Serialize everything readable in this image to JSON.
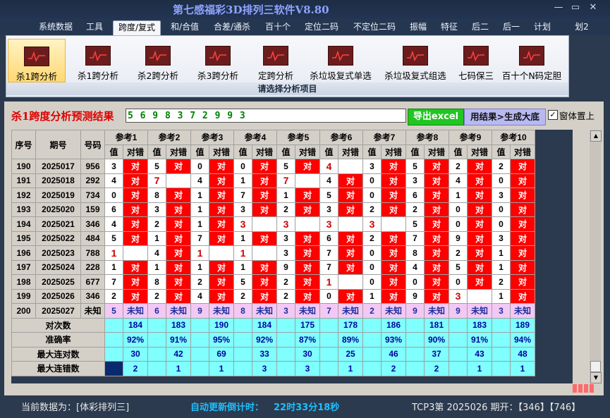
{
  "window": {
    "title": "第七感福彩3D排列三软件V8.80",
    "min": "—",
    "max": "▭",
    "close": "✕"
  },
  "menu": [
    "系统数据",
    "工具",
    "跨度/复式",
    "和/合值",
    "合差/通杀",
    "百十个",
    "定位二码",
    "不定位二码",
    "振幅",
    "特征",
    "后二",
    "后一",
    "计划",
    "划2"
  ],
  "menu_active": 2,
  "ribbon": {
    "buttons": [
      "杀1跨分析",
      "杀1跨分析",
      "杀2跨分析",
      "杀3跨分析",
      "定跨分析",
      "杀垃圾复式单选",
      "杀垃圾复式组选",
      "七码保三",
      "百十个N码定胆"
    ],
    "active": 0,
    "group_label": "请选择分析项目"
  },
  "result": {
    "heading": "杀1跨度分析预测结果",
    "digits": "5 6 9 8 3 7 2 9 9 3",
    "export_label": "导出excel",
    "generate_label": "用结果>生成大底",
    "pin_label": "窗体置上",
    "pin_checked": "✓"
  },
  "table": {
    "col_headers": {
      "seq": "序号",
      "period": "期号",
      "code": "号码",
      "val": "值",
      "mark": "对错"
    },
    "refs": [
      "参考1",
      "参考2",
      "参考3",
      "参考4",
      "参考5",
      "参考6",
      "参考7",
      "参考8",
      "参考9",
      "参考10"
    ],
    "rows": [
      {
        "seq": "190",
        "period": "2025017",
        "code": "956",
        "cells": [
          [
            "3",
            "对"
          ],
          [
            "5",
            "对"
          ],
          [
            "0",
            "对"
          ],
          [
            "0",
            "对"
          ],
          [
            "5",
            "对"
          ],
          [
            "4",
            ""
          ],
          [
            "3",
            "对"
          ],
          [
            "5",
            "对"
          ],
          [
            "2",
            "对"
          ],
          [
            "2",
            "对"
          ]
        ]
      },
      {
        "seq": "191",
        "period": "2025018",
        "code": "292",
        "cells": [
          [
            "4",
            "对"
          ],
          [
            "7",
            ""
          ],
          [
            "4",
            "对"
          ],
          [
            "1",
            "对"
          ],
          [
            "7",
            ""
          ],
          [
            "4",
            "对"
          ],
          [
            "0",
            "对"
          ],
          [
            "3",
            "对"
          ],
          [
            "4",
            "对"
          ],
          [
            "0",
            "对"
          ]
        ]
      },
      {
        "seq": "192",
        "period": "2025019",
        "code": "734",
        "cells": [
          [
            "0",
            "对"
          ],
          [
            "8",
            "对"
          ],
          [
            "1",
            "对"
          ],
          [
            "7",
            "对"
          ],
          [
            "1",
            "对"
          ],
          [
            "5",
            "对"
          ],
          [
            "0",
            "对"
          ],
          [
            "6",
            "对"
          ],
          [
            "1",
            "对"
          ],
          [
            "3",
            "对"
          ]
        ]
      },
      {
        "seq": "193",
        "period": "2025020",
        "code": "159",
        "cells": [
          [
            "6",
            "对"
          ],
          [
            "3",
            "对"
          ],
          [
            "1",
            "对"
          ],
          [
            "3",
            "对"
          ],
          [
            "2",
            "对"
          ],
          [
            "3",
            "对"
          ],
          [
            "2",
            "对"
          ],
          [
            "2",
            "对"
          ],
          [
            "0",
            "对"
          ],
          [
            "0",
            "对"
          ]
        ]
      },
      {
        "seq": "194",
        "period": "2025021",
        "code": "346",
        "cells": [
          [
            "4",
            "对"
          ],
          [
            "2",
            "对"
          ],
          [
            "1",
            "对"
          ],
          [
            "3",
            ""
          ],
          [
            "3",
            ""
          ],
          [
            "3",
            ""
          ],
          [
            "3",
            ""
          ],
          [
            "5",
            "对"
          ],
          [
            "0",
            "对"
          ],
          [
            "0",
            "对"
          ]
        ]
      },
      {
        "seq": "195",
        "period": "2025022",
        "code": "484",
        "cells": [
          [
            "5",
            "对"
          ],
          [
            "1",
            "对"
          ],
          [
            "7",
            "对"
          ],
          [
            "1",
            "对"
          ],
          [
            "3",
            "对"
          ],
          [
            "6",
            "对"
          ],
          [
            "2",
            "对"
          ],
          [
            "7",
            "对"
          ],
          [
            "9",
            "对"
          ],
          [
            "3",
            "对"
          ]
        ]
      },
      {
        "seq": "196",
        "period": "2025023",
        "code": "788",
        "cells": [
          [
            "1",
            ""
          ],
          [
            "4",
            "对"
          ],
          [
            "1",
            ""
          ],
          [
            "1",
            ""
          ],
          [
            "3",
            "对"
          ],
          [
            "7",
            "对"
          ],
          [
            "0",
            "对"
          ],
          [
            "8",
            "对"
          ],
          [
            "2",
            "对"
          ],
          [
            "1",
            "对"
          ]
        ]
      },
      {
        "seq": "197",
        "period": "2025024",
        "code": "228",
        "cells": [
          [
            "1",
            "对"
          ],
          [
            "1",
            "对"
          ],
          [
            "1",
            "对"
          ],
          [
            "1",
            "对"
          ],
          [
            "9",
            "对"
          ],
          [
            "7",
            "对"
          ],
          [
            "0",
            "对"
          ],
          [
            "4",
            "对"
          ],
          [
            "5",
            "对"
          ],
          [
            "1",
            "对"
          ]
        ]
      },
      {
        "seq": "198",
        "period": "2025025",
        "code": "677",
        "cells": [
          [
            "7",
            "对"
          ],
          [
            "8",
            "对"
          ],
          [
            "2",
            "对"
          ],
          [
            "5",
            "对"
          ],
          [
            "2",
            "对"
          ],
          [
            "1",
            ""
          ],
          [
            "0",
            "对"
          ],
          [
            "0",
            "对"
          ],
          [
            "0",
            "对"
          ],
          [
            "2",
            "对"
          ]
        ]
      },
      {
        "seq": "199",
        "period": "2025026",
        "code": "346",
        "cells": [
          [
            "2",
            "对"
          ],
          [
            "2",
            "对"
          ],
          [
            "4",
            "对"
          ],
          [
            "2",
            "对"
          ],
          [
            "2",
            "对"
          ],
          [
            "0",
            "对"
          ],
          [
            "1",
            "对"
          ],
          [
            "9",
            "对"
          ],
          [
            "3",
            ""
          ],
          [
            "1",
            "对"
          ]
        ]
      }
    ],
    "pending": {
      "seq": "200",
      "period": "2025027",
      "code": "未知",
      "cells": [
        [
          "5",
          "未知"
        ],
        [
          "6",
          "未知"
        ],
        [
          "9",
          "未知"
        ],
        [
          "8",
          "未知"
        ],
        [
          "3",
          "未知"
        ],
        [
          "7",
          "未知"
        ],
        [
          "2",
          "未知"
        ],
        [
          "9",
          "未知"
        ],
        [
          "9",
          "未知"
        ],
        [
          "3",
          "未知"
        ]
      ]
    },
    "stats": [
      {
        "label": "对次数",
        "values": [
          "184",
          "183",
          "190",
          "184",
          "175",
          "178",
          "186",
          "181",
          "183",
          "189"
        ]
      },
      {
        "label": "准确率",
        "values": [
          "92%",
          "91%",
          "95%",
          "92%",
          "87%",
          "89%",
          "93%",
          "90%",
          "91%",
          "94%"
        ]
      },
      {
        "label": "最大连对数",
        "values": [
          "30",
          "42",
          "69",
          "33",
          "30",
          "25",
          "46",
          "37",
          "43",
          "48"
        ]
      },
      {
        "label": "最大连错数",
        "values": [
          "2",
          "1",
          "1",
          "3",
          "3",
          "1",
          "2",
          "2",
          "1",
          "1"
        ]
      }
    ]
  },
  "status": {
    "current_data": "当前数据为：[体彩排列三]",
    "countdown_label": "自动更新倒计时：",
    "countdown_value": "22时33分18秒",
    "draw_info": "TCP3第 2025026 期开：【346】【746】"
  },
  "colors": {
    "hit": "#ff0000",
    "pending": "#f4c8f4",
    "stats": "#80ffff"
  }
}
